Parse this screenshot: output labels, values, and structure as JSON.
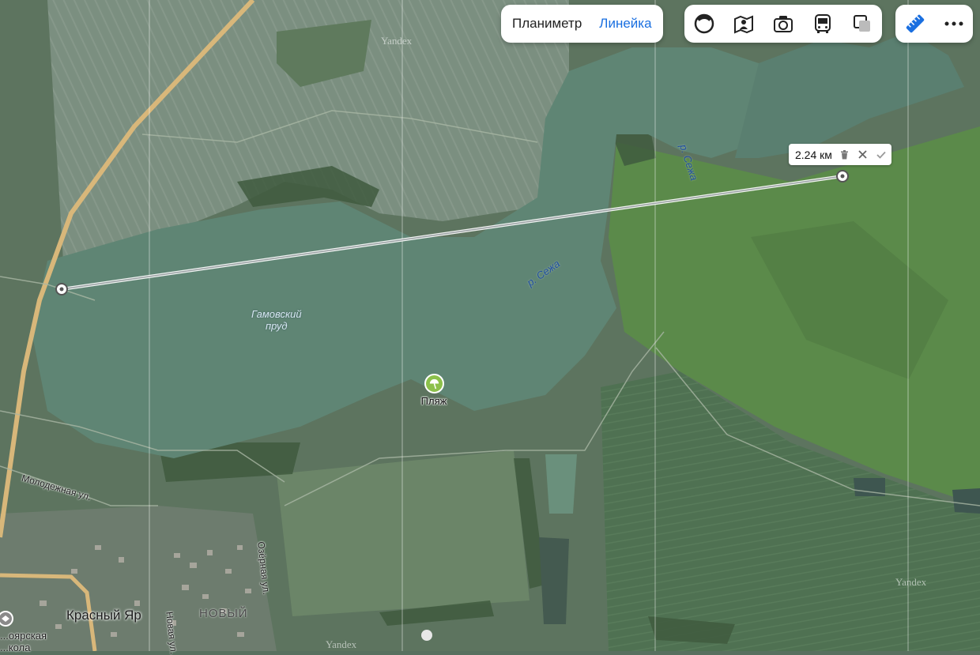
{
  "toolbar": {
    "tabs": [
      {
        "label": "Планиметр",
        "active": false
      },
      {
        "label": "Линейка",
        "active": true
      }
    ],
    "layers": [
      {
        "icon": "panorama-circle-icon"
      },
      {
        "icon": "map-layers-person-icon"
      },
      {
        "icon": "camera-icon"
      },
      {
        "icon": "bus-icon"
      },
      {
        "icon": "layers-squares-icon"
      }
    ],
    "ruler_icon": "ruler-icon",
    "more_icon": "more-dots-icon",
    "accent": "#1a6fe0"
  },
  "measurement": {
    "distance": "2.24 км",
    "delete_icon": "trash-icon",
    "cancel_icon": "close-icon",
    "confirm_icon": "check-icon"
  },
  "map": {
    "lake_name": [
      "Гамовский",
      "пруд"
    ],
    "river_labels": [
      "р. Сежа",
      "р. Сежа"
    ],
    "poi": {
      "name": "Пляж",
      "icon": "beach-umbrella-icon",
      "color": "#8cc04b"
    },
    "streets": [
      "Молодежная ул.",
      "Озёрная ул.",
      "Новая ул."
    ],
    "places": [
      "Красный Яр",
      "НОВЫЙ"
    ],
    "school_label": [
      "...оярская",
      "...кола"
    ],
    "watermark": "Yandex"
  }
}
